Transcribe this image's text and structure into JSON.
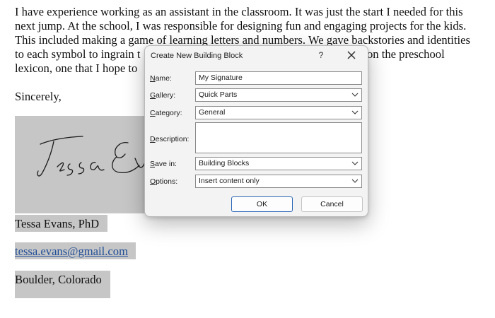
{
  "letter": {
    "lines": [
      "I have experience working as an assistant in the classroom. It was just the start I needed for this",
      "next jump. At the school, I was responsible for designing fun and engaging projects for the kids.",
      "This included making a game of learning letters and numbers. We gave backstories and identities",
      "to each symbol to ingrain t",
      "lexicon, one that I hope to"
    ],
    "line4_tail": "on the preschool",
    "closing": "Sincerely,",
    "signature_text": "Tessa Ev",
    "name": "Tessa Evans, PhD",
    "email": "tessa.evans@gmail.com",
    "location": "Boulder, Colorado"
  },
  "dialog": {
    "title": "Create New Building Block",
    "help": "?",
    "fields": {
      "name": {
        "label_key": "N",
        "label_rest": "ame:",
        "value": "My Signature"
      },
      "gallery": {
        "label_key": "G",
        "label_rest": "allery:",
        "value": "Quick Parts"
      },
      "category": {
        "label_key": "C",
        "label_rest": "ategory:",
        "value": "General"
      },
      "description": {
        "label_key": "D",
        "label_rest": "escription:",
        "value": ""
      },
      "save_in": {
        "label_key": "S",
        "label_rest": "ave in:",
        "value": "Building Blocks"
      },
      "options": {
        "label_key": "O",
        "label_rest": "ptions:",
        "value": "Insert content only"
      }
    },
    "ok_label": "OK",
    "cancel_label": "Cancel"
  },
  "icons": {
    "close": "close-icon",
    "chevron": "chevron-down-icon"
  },
  "colors": {
    "selection": "#c6c6c6",
    "link": "#1f4e99",
    "ok_border": "#2a67b7"
  }
}
